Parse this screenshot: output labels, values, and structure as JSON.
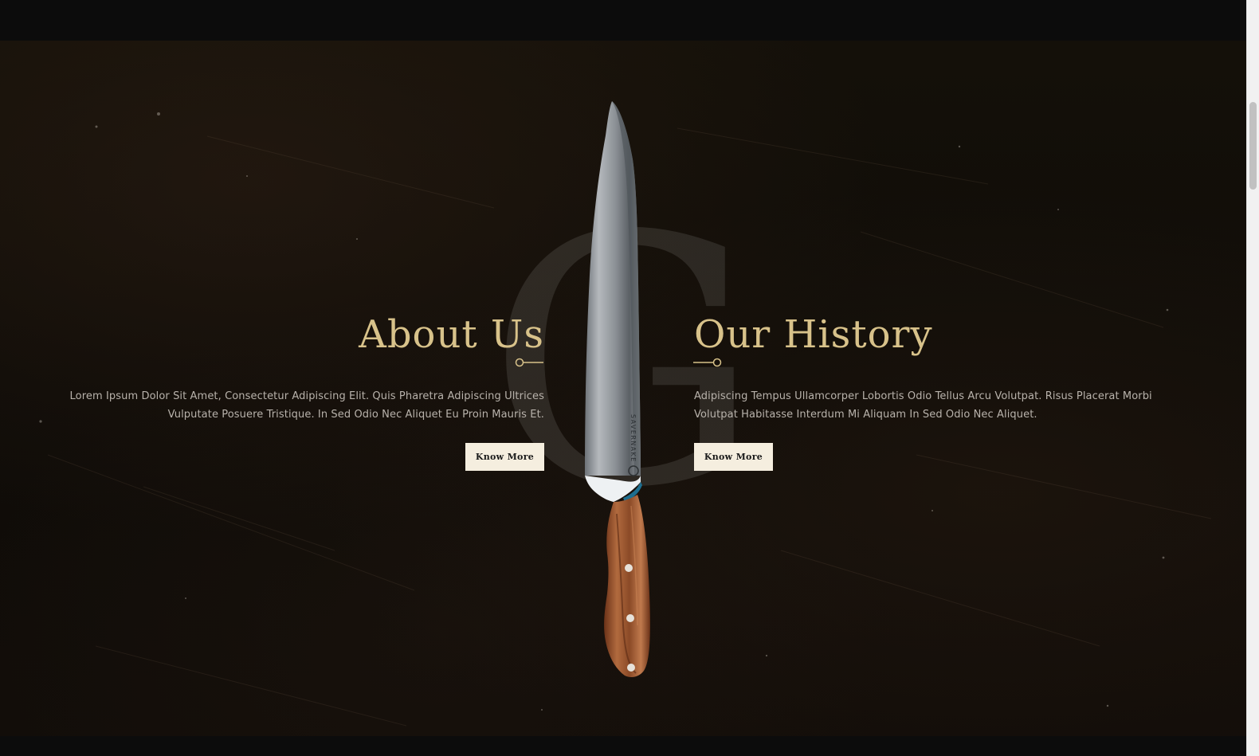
{
  "hero": {
    "watermark_letter": "G",
    "knife_brand": "SAVERNAKE"
  },
  "about": {
    "title": "About Us",
    "text": "Lorem Ipsum Dolor Sit Amet, Consectetur Adipiscing Elit. Quis Pharetra Adipiscing Ultrices Vulputate Posuere Tristique. In Sed Odio Nec Aliquet Eu Proin Mauris Et.",
    "button_label": "Know More"
  },
  "history": {
    "title": "Our History",
    "text": "Adipiscing Tempus Ullamcorper Lobortis Odio Tellus Arcu Volutpat. Risus Placerat Morbi Volutpat Habitasse Interdum Mi Aliquam In Sed Odio Nec Aliquet.",
    "button_label": "Know More"
  },
  "colors": {
    "background": "#120d09",
    "accent_gold": "#d8c28a",
    "button_bg": "#f5eedf",
    "body_text": "#b8b2ab"
  },
  "icons": {
    "knife_image": "chef-knife-icon",
    "divider_left": "title-divider-icon",
    "divider_right": "title-divider-icon"
  },
  "scroll": {
    "position": 0.14
  }
}
